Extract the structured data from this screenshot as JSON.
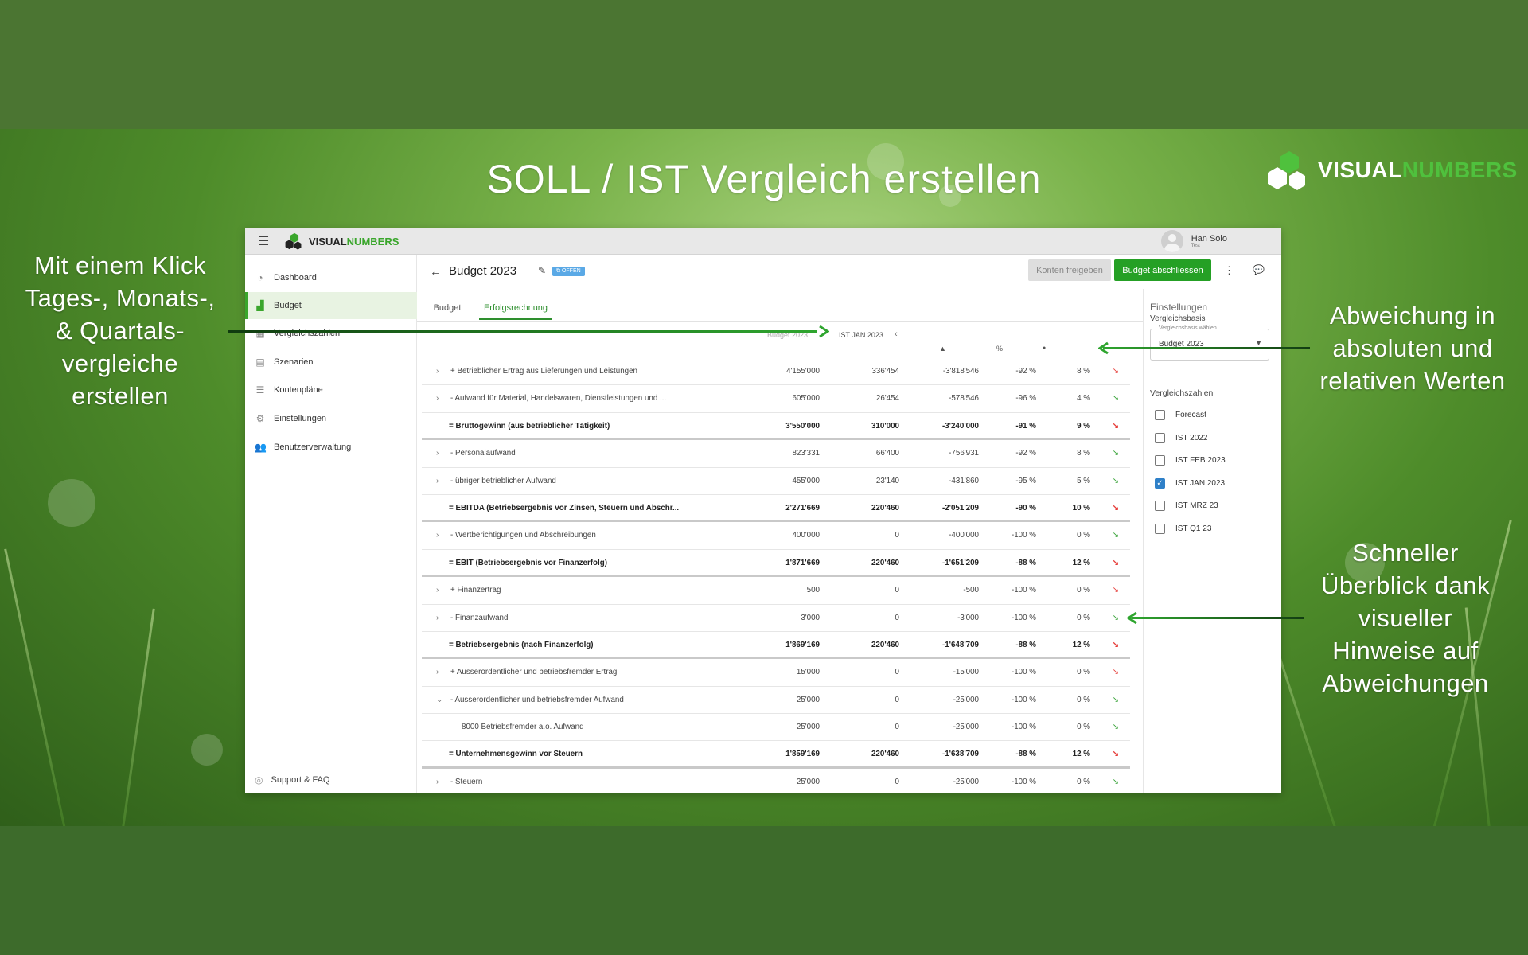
{
  "banner": {
    "headline": "SOLL / IST Vergleich erstellen",
    "brand_left": "VISUAL",
    "brand_right": "NUMBERS",
    "note_left": [
      "Mit einem Klick",
      "Tages-,  Monats-,",
      "& Quartals-",
      "vergleiche",
      "erstellen"
    ],
    "note_right_top": [
      "Abweichung in",
      "absoluten und",
      "relativen Werten"
    ],
    "note_right_bottom": [
      "Schneller",
      "Überblick dank",
      "visueller",
      "Hinweise auf",
      "Abweichungen"
    ]
  },
  "colors": {
    "brand_green": "#4fc13d",
    "primary_button": "#25a025",
    "increase": "#e53935",
    "decrease": "#2e9e2e"
  },
  "app": {
    "logo_left": "VISUAL",
    "logo_right": "NUMBERS",
    "user_name": "Han Solo",
    "user_role": "Test",
    "nav": [
      {
        "label": "Dashboard",
        "icon": "gauge-icon"
      },
      {
        "label": "Budget",
        "icon": "chart-icon"
      },
      {
        "label": "Vergleichszahlen",
        "icon": "table-icon"
      },
      {
        "label": "Szenarien",
        "icon": "layers-icon"
      },
      {
        "label": "Kontenpläne",
        "icon": "list-icon"
      },
      {
        "label": "Einstellungen",
        "icon": "gear-icon"
      },
      {
        "label": "Benutzerverwaltung",
        "icon": "users-icon"
      }
    ],
    "support": "Support & FAQ",
    "page_title": "Budget 2023",
    "status_badge": "OFFEN",
    "btn_release": "Konten freigeben",
    "btn_close": "Budget abschliessen",
    "tabs": [
      "Budget",
      "Erfolgsrechnung"
    ],
    "col_budget": "Budget 2023",
    "col_compare": "IST JAN 2023",
    "sym_abs": "▲",
    "sym_pct": "%",
    "sym_share": "●",
    "rows": [
      {
        "label": "+ Betrieblicher Ertrag aus Lieferungen und Leistungen",
        "budget": "4'155'000",
        "ist": "336'454",
        "diff": "-3'818'546",
        "pct": "-92 %",
        "share": "8 %",
        "trend": "up",
        "exp": "›"
      },
      {
        "label": "- Aufwand für Material, Handelswaren, Dienstleistungen und ...",
        "budget": "605'000",
        "ist": "26'454",
        "diff": "-578'546",
        "pct": "-96 %",
        "share": "4 %",
        "trend": "down",
        "exp": "›"
      },
      {
        "label": "= Bruttogewinn (aus betrieblicher Tätigkeit)",
        "budget": "3'550'000",
        "ist": "310'000",
        "diff": "-3'240'000",
        "pct": "-91 %",
        "share": "9 %",
        "trend": "up",
        "total": true
      },
      {
        "label": "- Personalaufwand",
        "budget": "823'331",
        "ist": "66'400",
        "diff": "-756'931",
        "pct": "-92 %",
        "share": "8 %",
        "trend": "down",
        "exp": "›"
      },
      {
        "label": "- übriger betrieblicher Aufwand",
        "budget": "455'000",
        "ist": "23'140",
        "diff": "-431'860",
        "pct": "-95 %",
        "share": "5 %",
        "trend": "down",
        "exp": "›"
      },
      {
        "label": "= EBITDA (Betriebsergebnis vor Zinsen, Steuern und Abschr...",
        "budget": "2'271'669",
        "ist": "220'460",
        "diff": "-2'051'209",
        "pct": "-90 %",
        "share": "10 %",
        "trend": "up",
        "total": true
      },
      {
        "label": "- Wertberichtigungen und Abschreibungen",
        "budget": "400'000",
        "ist": "0",
        "diff": "-400'000",
        "pct": "-100 %",
        "share": "0 %",
        "trend": "down",
        "exp": "›"
      },
      {
        "label": "= EBIT (Betriebsergebnis vor Finanzerfolg)",
        "budget": "1'871'669",
        "ist": "220'460",
        "diff": "-1'651'209",
        "pct": "-88 %",
        "share": "12 %",
        "trend": "up",
        "total": true
      },
      {
        "label": "+ Finanzertrag",
        "budget": "500",
        "ist": "0",
        "diff": "-500",
        "pct": "-100 %",
        "share": "0 %",
        "trend": "up",
        "exp": "›"
      },
      {
        "label": "- Finanzaufwand",
        "budget": "3'000",
        "ist": "0",
        "diff": "-3'000",
        "pct": "-100 %",
        "share": "0 %",
        "trend": "down",
        "exp": "›"
      },
      {
        "label": "= Betriebsergebnis (nach Finanzerfolg)",
        "budget": "1'869'169",
        "ist": "220'460",
        "diff": "-1'648'709",
        "pct": "-88 %",
        "share": "12 %",
        "trend": "up",
        "total": true
      },
      {
        "label": "+ Ausserordentlicher und betriebsfremder Ertrag",
        "budget": "15'000",
        "ist": "0",
        "diff": "-15'000",
        "pct": "-100 %",
        "share": "0 %",
        "trend": "up",
        "exp": "›"
      },
      {
        "label": "- Ausserordentlicher und betriebsfremder Aufwand",
        "budget": "25'000",
        "ist": "0",
        "diff": "-25'000",
        "pct": "-100 %",
        "share": "0 %",
        "trend": "down",
        "exp": "⌄"
      },
      {
        "label": "8000 Betriebsfremder a.o. Aufwand",
        "budget": "25'000",
        "ist": "0",
        "diff": "-25'000",
        "pct": "-100 %",
        "share": "0 %",
        "trend": "down",
        "sub": true
      },
      {
        "label": "= Unternehmensgewinn vor Steuern",
        "budget": "1'859'169",
        "ist": "220'460",
        "diff": "-1'638'709",
        "pct": "-88 %",
        "share": "12 %",
        "trend": "up",
        "total": true
      },
      {
        "label": "- Steuern",
        "budget": "25'000",
        "ist": "0",
        "diff": "-25'000",
        "pct": "-100 %",
        "share": "0 %",
        "trend": "down",
        "exp": "›"
      }
    ],
    "panel": {
      "title": "Einstellungen",
      "basis_label": "Vergleichsbasis",
      "select_legend": "Vergleichsbasis wählen",
      "select_value": "Budget 2023",
      "compare_label": "Vergleichszahlen",
      "options": [
        {
          "label": "Forecast",
          "checked": false
        },
        {
          "label": "IST 2022",
          "checked": false
        },
        {
          "label": "IST FEB 2023",
          "checked": false
        },
        {
          "label": "IST JAN 2023",
          "checked": true
        },
        {
          "label": "IST MRZ 23",
          "checked": false
        },
        {
          "label": "IST Q1 23",
          "checked": false
        }
      ]
    }
  }
}
